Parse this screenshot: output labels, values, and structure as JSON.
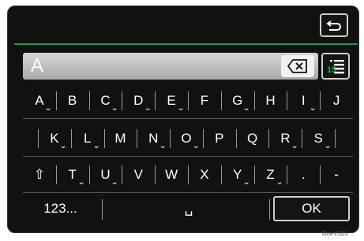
{
  "header": {
    "back_icon": "back-arrow-icon"
  },
  "input": {
    "value": "A",
    "backspace_icon": "backspace-icon"
  },
  "list": {
    "icon": "list-icon",
    "count": "15"
  },
  "keyboard": {
    "row1": [
      {
        "label": "A",
        "accent": "⌄"
      },
      {
        "label": "B",
        "accent": ""
      },
      {
        "label": "C",
        "accent": "⌄"
      },
      {
        "label": "D",
        "accent": "⌄"
      },
      {
        "label": "E",
        "accent": "⌄"
      },
      {
        "label": "F",
        "accent": ""
      },
      {
        "label": "G",
        "accent": "⌄"
      },
      {
        "label": "H",
        "accent": ""
      },
      {
        "label": "I",
        "accent": "⌄"
      },
      {
        "label": "J",
        "accent": ""
      }
    ],
    "row2": [
      {
        "label": "K",
        "accent": "⌄"
      },
      {
        "label": "L",
        "accent": "⌄"
      },
      {
        "label": "M",
        "accent": ""
      },
      {
        "label": "N",
        "accent": "⌄"
      },
      {
        "label": "O",
        "accent": "⌄"
      },
      {
        "label": "P",
        "accent": ""
      },
      {
        "label": "Q",
        "accent": ""
      },
      {
        "label": "R",
        "accent": "⌄"
      },
      {
        "label": "S",
        "accent": "⌄"
      }
    ],
    "row3": [
      {
        "label": "⇧",
        "accent": ""
      },
      {
        "label": "T",
        "accent": "⌄"
      },
      {
        "label": "U",
        "accent": "⌄"
      },
      {
        "label": "V",
        "accent": ""
      },
      {
        "label": "W",
        "accent": ""
      },
      {
        "label": "X",
        "accent": ""
      },
      {
        "label": "Y",
        "accent": "⌄"
      },
      {
        "label": "Z",
        "accent": "⌄"
      },
      {
        "label": ".",
        "accent": ""
      },
      {
        "label": "-",
        "accent": ""
      }
    ],
    "numbers_label": "123...",
    "space_label": "␣",
    "ok_label": "OK"
  },
  "figure_ref": "Bra-2520",
  "colors": {
    "accent_green": "#1e9a4a",
    "background": "#111111"
  }
}
